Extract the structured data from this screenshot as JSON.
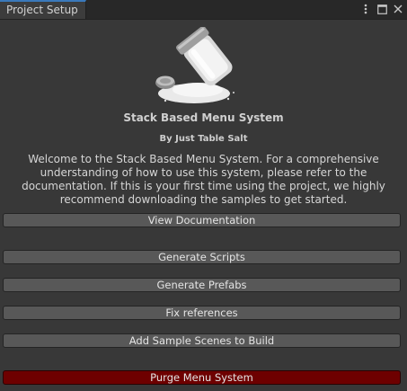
{
  "window": {
    "tab_title": "Project Setup",
    "icons": [
      "more-vert-icon",
      "maximize-icon",
      "close-icon"
    ]
  },
  "header": {
    "title": "Stack Based Menu System",
    "author": "By Just Table Salt",
    "logo": "salt-shaker-logo"
  },
  "welcome_text": "Welcome to the Stack Based Menu System. For a comprehensive understanding of how to use this system, please refer to the documentation. If this is your first time using the project, we highly recommend downloading the samples to get started.",
  "buttons": {
    "view_docs": "View Documentation",
    "generate_scripts": "Generate Scripts",
    "generate_prefabs": "Generate Prefabs",
    "fix_references": "Fix references",
    "add_sample_scenes": "Add Sample Scenes to Build",
    "purge": "Purge Menu System"
  },
  "colors": {
    "background": "#383838",
    "button": "#585858",
    "danger_button": "#6e0000",
    "tab_accent": "#3a79bb"
  }
}
